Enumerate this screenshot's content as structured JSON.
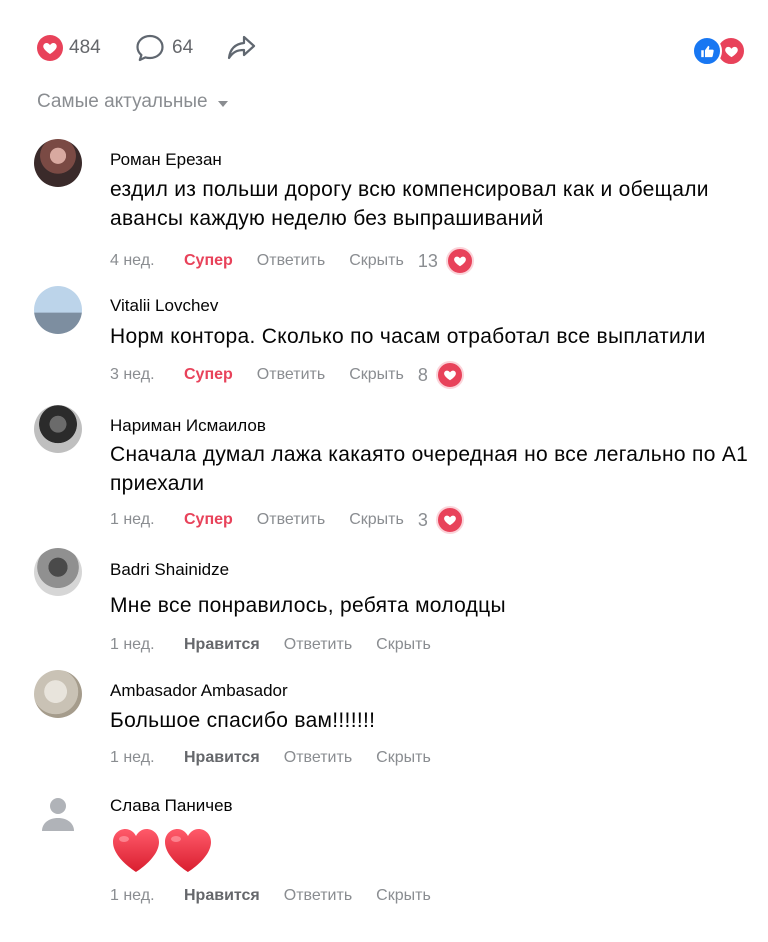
{
  "topbar": {
    "likes_count": "484",
    "comments_count": "64",
    "accent": "#e8425a",
    "like_blue": "#1877f2"
  },
  "sort": {
    "label": "Самые актуальные"
  },
  "comments": [
    {
      "author": "Роман Ерезан",
      "text": "ездил из польши дорогу всю компенсировал как и обещали авансы каждую неделю без выпрашиваний",
      "time": "4 нед.",
      "reaction_label": "Супер",
      "reply": "Ответить",
      "hide": "Скрыть",
      "reaction_count": "13"
    },
    {
      "author": "Vitalii Lovchev",
      "text": "Норм контора. Сколько по часам отработал все выплатили",
      "time": "3 нед.",
      "reaction_label": "Супер",
      "reply": "Ответить",
      "hide": "Скрыть",
      "reaction_count": "8"
    },
    {
      "author": "Нариман Исмаилов",
      "text": "Сначала думал лажа какаято очередная но все легально по А1 приехали",
      "time": "1 нед.",
      "reaction_label": "Супер",
      "reply": "Ответить",
      "hide": "Скрыть",
      "reaction_count": "3"
    },
    {
      "author": "Badri Shainidze",
      "text": "Мне все понравилось, ребята молодцы",
      "time": "1 нед.",
      "reaction_label": "Нравится",
      "reply": "Ответить",
      "hide": "Скрыть"
    },
    {
      "author": "Ambasador Ambasador",
      "text": "Большое спасибо вам!!!!!!!",
      "time": "1 нед.",
      "reaction_label": "Нравится",
      "reply": "Ответить",
      "hide": "Скрыть"
    },
    {
      "author": "Слава Паничев",
      "text": "",
      "time": "1 нед.",
      "reaction_label": "Нравится",
      "reply": "Ответить",
      "hide": "Скрыть"
    }
  ]
}
